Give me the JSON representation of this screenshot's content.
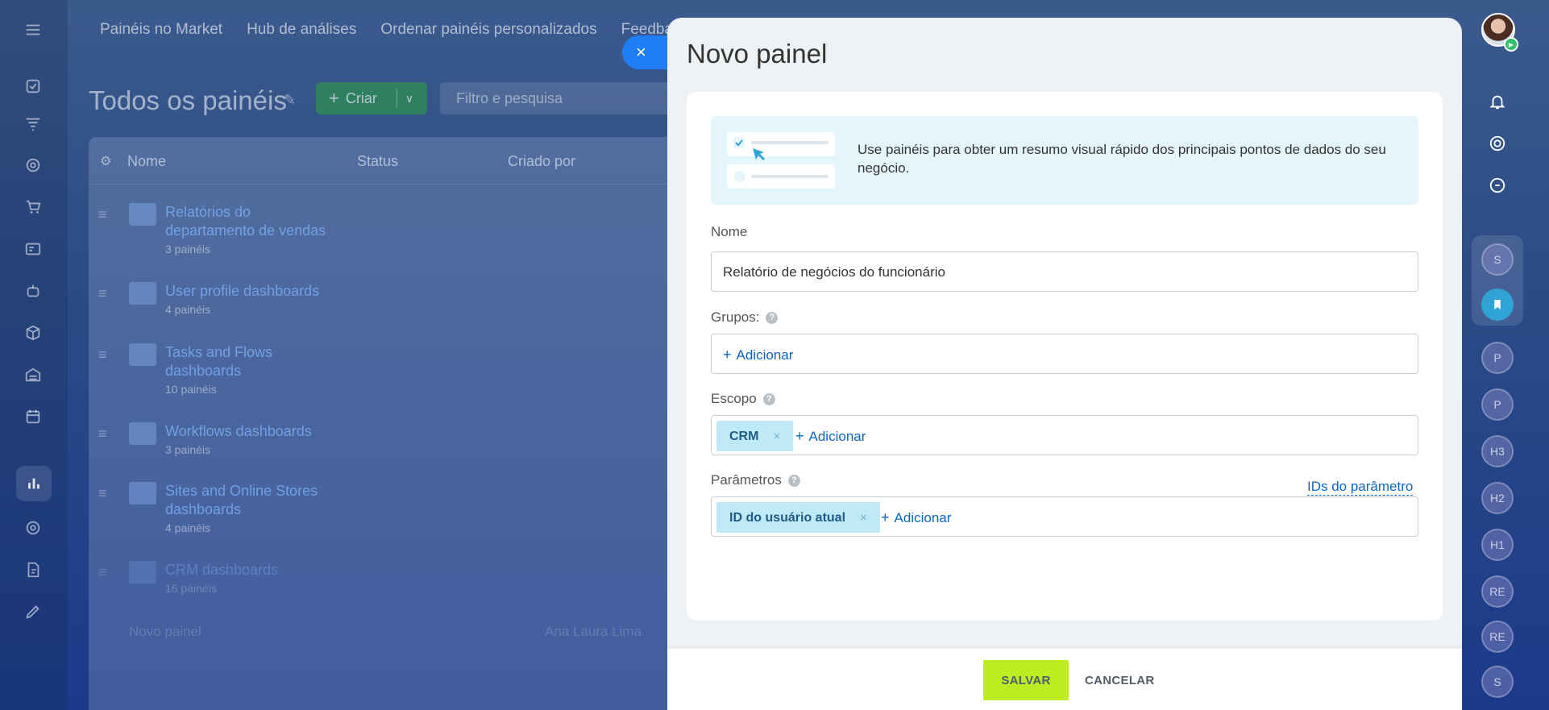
{
  "background": {
    "top_nav": [
      "Painéis no Market",
      "Hub de análises",
      "Ordenar painéis personalizados",
      "Feedback"
    ],
    "page_title": "Todos os painéis",
    "create_button": "Criar",
    "filter_placeholder": "Filtro e pesquisa",
    "table": {
      "columns": [
        "Nome",
        "Status",
        "Criado por"
      ],
      "rows": [
        {
          "name": "Relatórios do departamento de vendas",
          "count": "3 painéis"
        },
        {
          "name": "User profile dashboards",
          "count": "4 painéis"
        },
        {
          "name": "Tasks and Flows dashboards",
          "count": "10 painéis"
        },
        {
          "name": "Workflows dashboards",
          "count": "3 painéis"
        },
        {
          "name": "Sites and Online Stores dashboards",
          "count": "4 painéis"
        },
        {
          "name": "CRM dashboards",
          "count": "16 painéis"
        }
      ],
      "extra_row": {
        "name": "Novo painel",
        "author": "Ana Laura Lima"
      }
    },
    "right_bar_avatars": [
      "S",
      "P",
      "P",
      "H3",
      "H2",
      "H1",
      "RE",
      "RE",
      "S"
    ]
  },
  "slider": {
    "title": "Novo painel",
    "hint": "Use painéis para obter um resumo visual rápido dos principais pontos de dados do seu negócio.",
    "name_label": "Nome",
    "name_value": "Relatório de negócios do funcionário",
    "groups_label": "Grupos:",
    "scope_label": "Escopo",
    "scope_tag": "CRM",
    "params_label": "Parâmetros",
    "params_ids_link": "IDs do parâmetro",
    "params_tag": "ID do usuário atual",
    "add_label": "Adicionar",
    "save_button": "SALVAR",
    "cancel_button": "CANCELAR"
  },
  "colors": {
    "accent_blue": "#1e7ef5",
    "save_green": "#bbed21",
    "link_blue": "#0b66c3",
    "tag_bg": "#bfe9f7"
  }
}
